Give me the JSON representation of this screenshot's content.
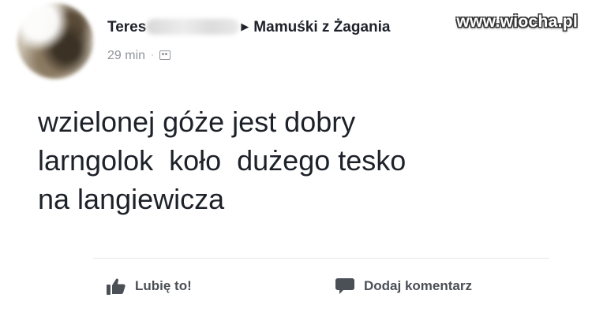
{
  "header": {
    "author_name": "Teres",
    "group_name": "Mamuśki z Żagania",
    "timestamp": "29 min",
    "separator": "·",
    "audience_icon": "group-icon"
  },
  "watermark": {
    "text": "www.wiocha.pl"
  },
  "post": {
    "lines": [
      "wzielonej góże jest dobry",
      "larngolok  koło  dużego tesko",
      "na langiewicza"
    ]
  },
  "actions": {
    "like": {
      "label": "Lubię to!",
      "icon": "thumbs-up-icon"
    },
    "comment": {
      "label": "Dodaj komentarz",
      "icon": "comment-icon"
    }
  },
  "colors": {
    "text": "#1d2129",
    "meta": "#90949c",
    "action": "#4b4f56",
    "divider": "#e5e6e9"
  }
}
